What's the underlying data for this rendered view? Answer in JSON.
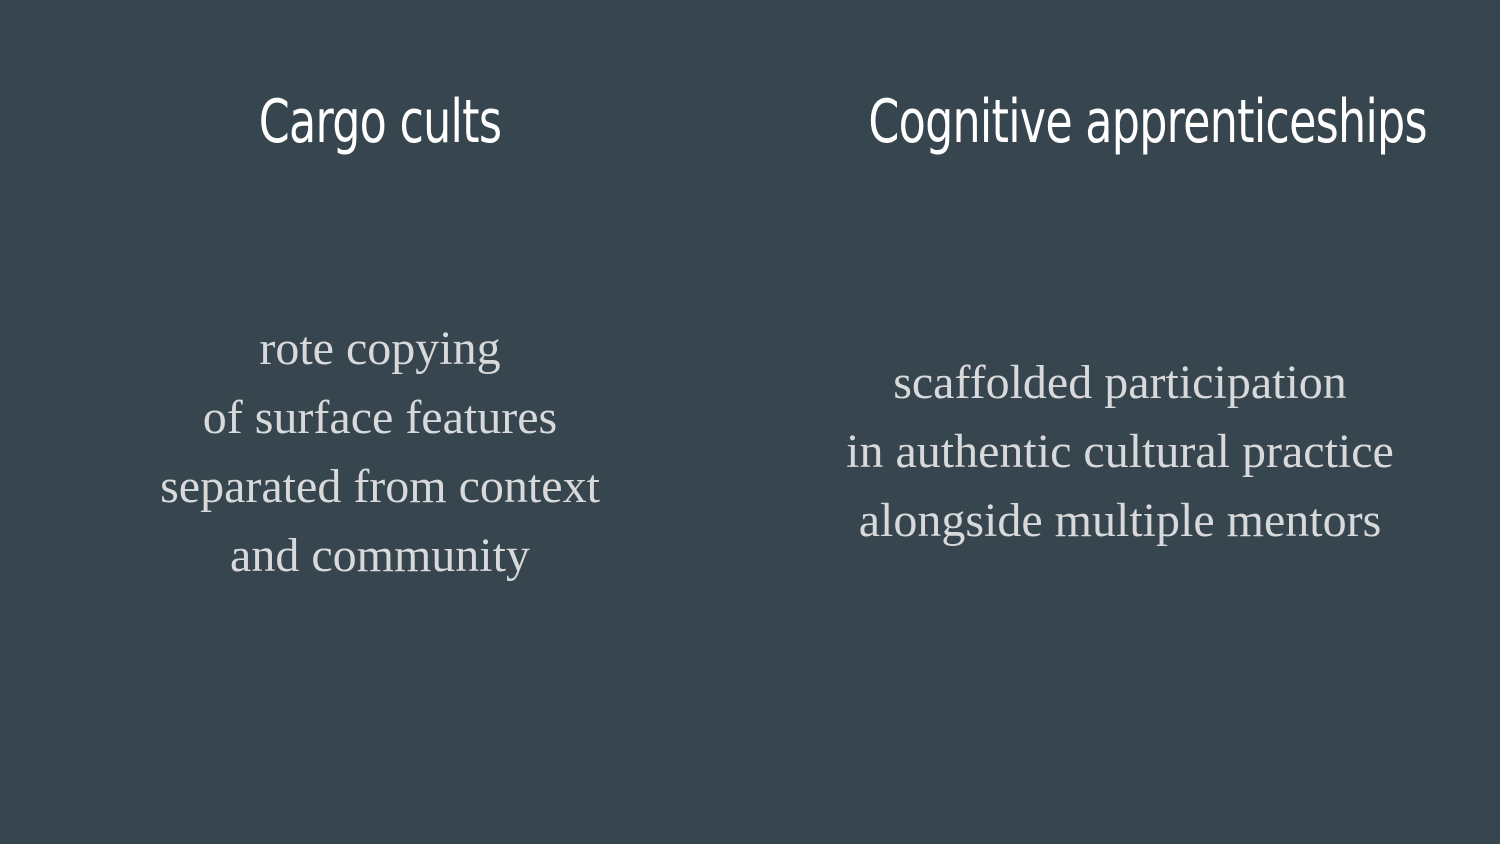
{
  "slide": {
    "background_color": "#37454f",
    "heading_color": "#ffffff",
    "body_color": "#d7d9da",
    "left": {
      "heading": "Cargo cults",
      "lines": [
        "rote copying",
        "of surface features",
        "separated from context",
        "and community"
      ]
    },
    "right": {
      "heading": "Cognitive apprenticeships",
      "lines": [
        "scaffolded participation",
        "in authentic cultural practice",
        "alongside multiple mentors"
      ]
    }
  }
}
